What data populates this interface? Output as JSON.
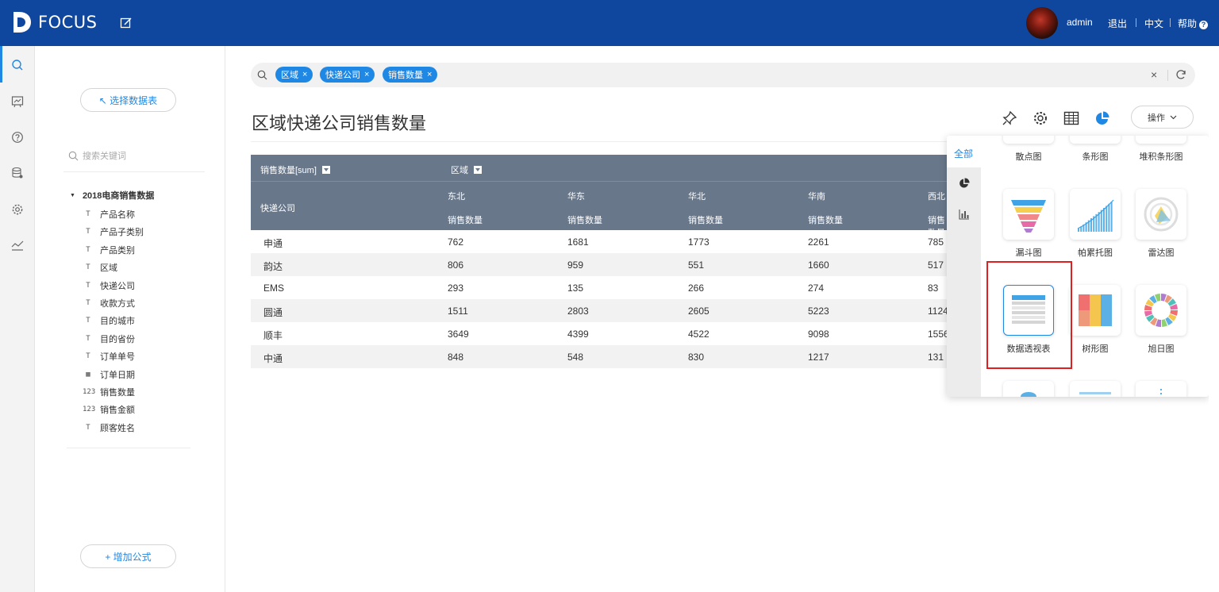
{
  "app": {
    "name": "FOCUS"
  },
  "topbar": {
    "user": "admin",
    "logout": "退出",
    "language": "中文",
    "help": "帮助",
    "help_badge": "?"
  },
  "rail": {
    "items": [
      "search-icon",
      "board-icon",
      "help-circle-icon",
      "database-icon",
      "gear-icon",
      "trend-icon"
    ]
  },
  "panel": {
    "select_table": "↖ 选择数据表",
    "keyword_placeholder": "搜索关键词",
    "table_name": "2018电商销售数据",
    "fields": [
      {
        "label": "产品名称",
        "type": "text"
      },
      {
        "label": "产品子类别",
        "type": "text"
      },
      {
        "label": "产品类别",
        "type": "text"
      },
      {
        "label": "区域",
        "type": "text"
      },
      {
        "label": "快递公司",
        "type": "text"
      },
      {
        "label": "收款方式",
        "type": "text"
      },
      {
        "label": "目的城市",
        "type": "text"
      },
      {
        "label": "目的省份",
        "type": "text"
      },
      {
        "label": "订单单号",
        "type": "text"
      },
      {
        "label": "订单日期",
        "type": "date"
      },
      {
        "label": "销售数量",
        "type": "number"
      },
      {
        "label": "销售金额",
        "type": "number"
      },
      {
        "label": "顾客姓名",
        "type": "text"
      }
    ],
    "add_formula": "+ 增加公式",
    "type_glyphs": {
      "text": "T",
      "date": "▦",
      "number": "123"
    }
  },
  "search": {
    "chips": [
      "区域",
      "快递公司",
      "销售数量"
    ],
    "chip_close": "×",
    "clear": "×"
  },
  "main": {
    "title": "区域快递公司销售数量",
    "operate_label": "操作"
  },
  "table": {
    "measure_header": "销售数量[sum]",
    "column_header": "区域",
    "row_header": "快递公司",
    "regions": [
      "东北",
      "华东",
      "华北",
      "华南",
      "西北"
    ],
    "sub_header": "销售数量",
    "rows": [
      {
        "name": "申通",
        "values": [
          "762",
          "1681",
          "1773",
          "2261",
          "785"
        ]
      },
      {
        "name": "韵达",
        "values": [
          "806",
          "959",
          "551",
          "1660",
          "517"
        ]
      },
      {
        "name": "EMS",
        "values": [
          "293",
          "135",
          "266",
          "274",
          "83"
        ]
      },
      {
        "name": "圆通",
        "values": [
          "1511",
          "2803",
          "2605",
          "5223",
          "1124"
        ]
      },
      {
        "name": "顺丰",
        "values": [
          "3649",
          "4399",
          "4522",
          "9098",
          "1556"
        ]
      },
      {
        "name": "中通",
        "values": [
          "848",
          "548",
          "830",
          "1217",
          "131"
        ]
      }
    ]
  },
  "chart_picker": {
    "tab_all": "全部",
    "top_labels": [
      "散点图",
      "条形图",
      "堆积条形图"
    ],
    "cards": [
      {
        "label": "漏斗图",
        "icon": "funnel-chart-icon"
      },
      {
        "label": "帕累托图",
        "icon": "pareto-chart-icon"
      },
      {
        "label": "雷达图",
        "icon": "radar-chart-icon"
      },
      {
        "label": "数据透视表",
        "icon": "pivot-table-icon",
        "selected": true
      },
      {
        "label": "树形图",
        "icon": "treemap-chart-icon"
      },
      {
        "label": "旭日图",
        "icon": "sunburst-chart-icon"
      }
    ]
  },
  "colors": {
    "topbar": "#0f479f",
    "accent": "#1f88e5",
    "table_header": "#68778a",
    "highlight": "#e02020"
  }
}
